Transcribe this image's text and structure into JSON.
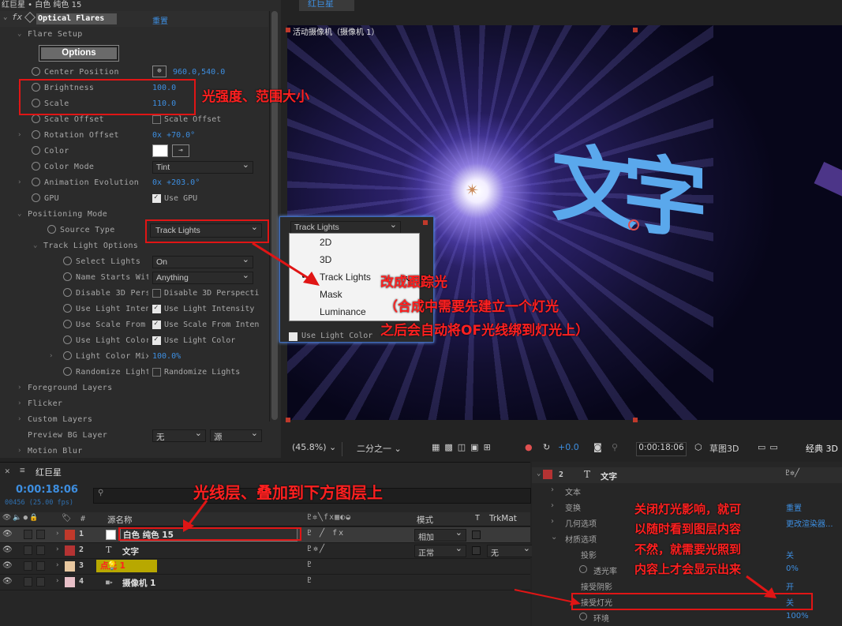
{
  "effects_panel": {
    "header": "红巨星 • 白色 纯色 15",
    "effect_name": "Optical Flares",
    "reset_label": "重置",
    "options_button": "Options",
    "rows": [
      {
        "label": "Flare Setup"
      },
      {
        "label": "Center Position",
        "value": "960.0,540.0"
      },
      {
        "label": "Brightness",
        "value": "100.0"
      },
      {
        "label": "Scale",
        "value": "110.0"
      },
      {
        "label": "Scale Offset",
        "checkbox_label": "Scale Offset",
        "checked": false
      },
      {
        "label": "Rotation Offset",
        "value_prefix": "0x",
        "value": "+70.0°"
      },
      {
        "label": "Color",
        "color": "#ffffff"
      },
      {
        "label": "Color Mode",
        "dropdown": "Tint"
      },
      {
        "label": "Animation Evolution",
        "value_prefix": "0x",
        "value": "+203.0°"
      },
      {
        "label": "GPU",
        "checkbox_label": "Use GPU",
        "checked": true
      },
      {
        "label": "Positioning Mode"
      },
      {
        "label": "Source Type",
        "dropdown": "Track Lights"
      },
      {
        "label": "Track Light Options"
      },
      {
        "label": "Select Lights",
        "dropdown": "On"
      },
      {
        "label": "Name Starts Wit",
        "dropdown": "Anything"
      },
      {
        "label": "Disable 3D Pers",
        "checkbox_label": "Disable 3D Perspecti",
        "checked": false
      },
      {
        "label": "Use Light Inten",
        "checkbox_label": "Use Light Intensity",
        "checked": true
      },
      {
        "label": "Use Scale From",
        "checkbox_label": "Use Scale From Inten",
        "checked": true
      },
      {
        "label": "Use Light Color",
        "checkbox_label": "Use Light Color",
        "checked": true
      },
      {
        "label": "Light Color Mix",
        "value": "100.0%"
      },
      {
        "label": "Randomize Light",
        "checkbox_label": "Randomize Lights",
        "checked": false
      },
      {
        "label": "Foreground Layers"
      },
      {
        "label": "Flicker"
      },
      {
        "label": "Custom Layers"
      },
      {
        "label": "Preview BG Layer",
        "dropdown": "无",
        "dropdown2": "源"
      },
      {
        "label": "Motion Blur"
      }
    ]
  },
  "viewer": {
    "tab": "红巨星",
    "camera_label": "活动摄像机（摄像机 1）",
    "overlay_text": "文字",
    "zoom": "(45.8%)",
    "resolution": "二分之一",
    "exposure": "+0.0",
    "timecode": "0:00:18:06",
    "renderer": "草图3D",
    "classic_label": "经典 3D"
  },
  "source_dropdown": {
    "current": "Track Lights",
    "options": [
      "2D",
      "3D",
      "Track Lights",
      "Mask",
      "Luminance"
    ],
    "selected": "Track Lights",
    "behind_checkbox": "Use Light Color"
  },
  "timeline": {
    "comp_name": "红巨星",
    "timecode": "0:00:18:06",
    "frame_info": "00456 (25.00 fps)",
    "columns": {
      "name": "源名称",
      "mode": "模式",
      "t": "T",
      "trkmat": "TrkMat"
    },
    "layers": [
      {
        "num": "1",
        "name": "白色 纯色 15",
        "color": "#c0392b",
        "mode": "相加",
        "type": "solid"
      },
      {
        "num": "2",
        "name": "文字",
        "color": "#b53333",
        "mode": "正常",
        "trkmat": "无",
        "type": "text"
      },
      {
        "num": "3",
        "name": "点光 1",
        "color": "#e8c8a0",
        "type": "light"
      },
      {
        "num": "4",
        "name": "摄像机 1",
        "color": "#e8c0c8",
        "type": "camera"
      }
    ]
  },
  "layer_props": {
    "layer_num": "2",
    "layer_name": "文字",
    "rows": [
      {
        "label": "文本"
      },
      {
        "label": "变换",
        "value": "重置"
      },
      {
        "label": "几何选项",
        "value": "更改渲染器..."
      },
      {
        "label": "材质选项"
      },
      {
        "label": "投影",
        "value": "关"
      },
      {
        "label": "透光率",
        "value": "0%"
      },
      {
        "label": "接受阴影",
        "value": "开"
      },
      {
        "label": "接受灯光",
        "value": "关"
      },
      {
        "label": "环境",
        "value": "100%"
      }
    ]
  },
  "annotations": {
    "brightness_note": "光强度、范围大小",
    "track_note_1": "改成跟踪光",
    "track_note_2": "（合成中需要先建立一个灯光",
    "track_note_3": "之后会自动将OF光线绑到灯光上）",
    "layer_note": "光线层、叠加到下方图层上",
    "light_note_1": "关闭灯光影响，就可",
    "light_note_2": "以随时看到图层内容",
    "light_note_3": "不然，就需要光照到",
    "light_note_4": "内容上才会显示出来"
  }
}
